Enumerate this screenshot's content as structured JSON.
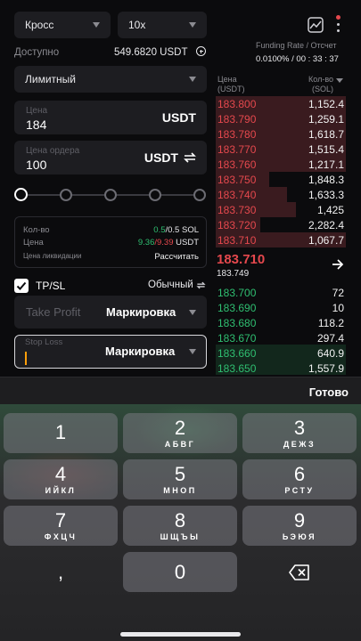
{
  "margin_mode": "Кросс",
  "leverage": "10x",
  "available": {
    "label": "Доступно",
    "value": "549.6820 USDT",
    "icon": "plus-circle-icon"
  },
  "funding": {
    "label": "Funding Rate / Отсчет",
    "value": "0.0100% / 00 : 33 : 37"
  },
  "order_type": "Лимитный",
  "price_field": {
    "label": "Цена",
    "value": "184",
    "unit": "USDT"
  },
  "order_price_field": {
    "label": "Цена ордера",
    "value": "100",
    "unit": "USDT",
    "icon": "swap-icon"
  },
  "slider": {
    "stops": 5,
    "selected": 0
  },
  "info": {
    "qty_label": "Кол-во",
    "qty_green": "0.5",
    "qty_rest": "/0.5 SOL",
    "price_label": "Цена",
    "price_green": "9.36",
    "price_red": "/9.39",
    "price_unit": " USDT",
    "liq_label": "Цена ликвидации",
    "liq_action": "Рассчитать"
  },
  "tpsl": {
    "label": "TP/SL",
    "checked": true,
    "mode": "Обычный"
  },
  "take_profit": {
    "placeholder": "Take Profit",
    "mode": "Маркировка"
  },
  "stop_loss": {
    "placeholder": "Stop Loss",
    "mode": "Маркировка"
  },
  "orderbook": {
    "price_header": "Цена",
    "price_unit": "(USDT)",
    "qty_header": "Кол-во",
    "qty_unit": "(SOL)",
    "asks": [
      {
        "price": "183.800",
        "qty": "1,152.4"
      },
      {
        "price": "183.790",
        "qty": "1,259.1"
      },
      {
        "price": "183.780",
        "qty": "1,618.7"
      },
      {
        "price": "183.770",
        "qty": "1,515.4"
      },
      {
        "price": "183.760",
        "qty": "1,217.1"
      },
      {
        "price": "183.750",
        "qty": "1,848.3"
      },
      {
        "price": "183.740",
        "qty": "1,633.3"
      },
      {
        "price": "183.730",
        "qty": "1,425"
      },
      {
        "price": "183.720",
        "qty": "2,282.4"
      },
      {
        "price": "183.710",
        "qty": "1,067.7"
      }
    ],
    "last_price": "183.710",
    "mark_price": "183.749",
    "bids": [
      {
        "price": "183.700",
        "qty": "72"
      },
      {
        "price": "183.690",
        "qty": "10"
      },
      {
        "price": "183.680",
        "qty": "118.2"
      },
      {
        "price": "183.670",
        "qty": "297.4"
      },
      {
        "price": "183.660",
        "qty": "640.9"
      },
      {
        "price": "183.650",
        "qty": "1,557.9"
      }
    ]
  },
  "keyboard": {
    "done_label": "Готово",
    "keys": [
      {
        "n": "1",
        "s": ""
      },
      {
        "n": "2",
        "s": "АБВГ"
      },
      {
        "n": "3",
        "s": "ДЕЖЗ"
      },
      {
        "n": "4",
        "s": "ИЙКЛ"
      },
      {
        "n": "5",
        "s": "МНОП"
      },
      {
        "n": "6",
        "s": "РСТУ"
      },
      {
        "n": "7",
        "s": "ФХЦЧ"
      },
      {
        "n": "8",
        "s": "ШЩЪЫ"
      },
      {
        "n": "9",
        "s": "ЬЭЮЯ"
      },
      {
        "n": ",",
        "s": ""
      },
      {
        "n": "0",
        "s": ""
      },
      {
        "n": "",
        "s": "",
        "icon": "backspace-icon"
      }
    ]
  },
  "colors": {
    "ask": "#e5484d",
    "bid": "#2fbf71",
    "background": "#0b0b0d"
  }
}
